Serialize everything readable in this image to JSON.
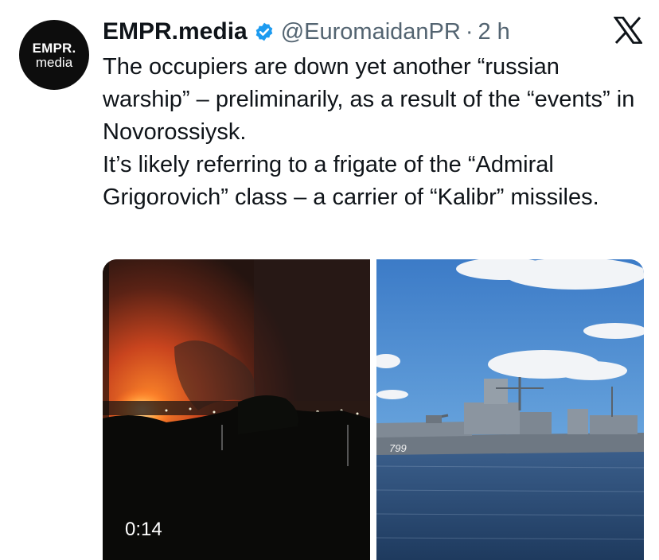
{
  "avatar": {
    "line1": "EMPR.",
    "line2": "media"
  },
  "header": {
    "display_name": "EMPR.media",
    "handle": "@EuromaidanPR",
    "separator": "·",
    "time": "2 h",
    "verified_icon": "verified-badge-icon",
    "platform_icon": "x-logo-icon"
  },
  "tweet": {
    "paragraph1": "The occupiers are down yet another “russian warship” – preliminarily, as a result of the “events” in Novorossiysk.",
    "paragraph2": "It’s likely referring to a frigate of the “Admiral Grigorovich” class – a carrier of “Kalibr” missiles."
  },
  "media": {
    "video_duration": "0:14",
    "ship_hull_number": "799"
  },
  "colors": {
    "verified": "#1d9bf0",
    "text": "#0f1419",
    "secondary": "#536471"
  }
}
